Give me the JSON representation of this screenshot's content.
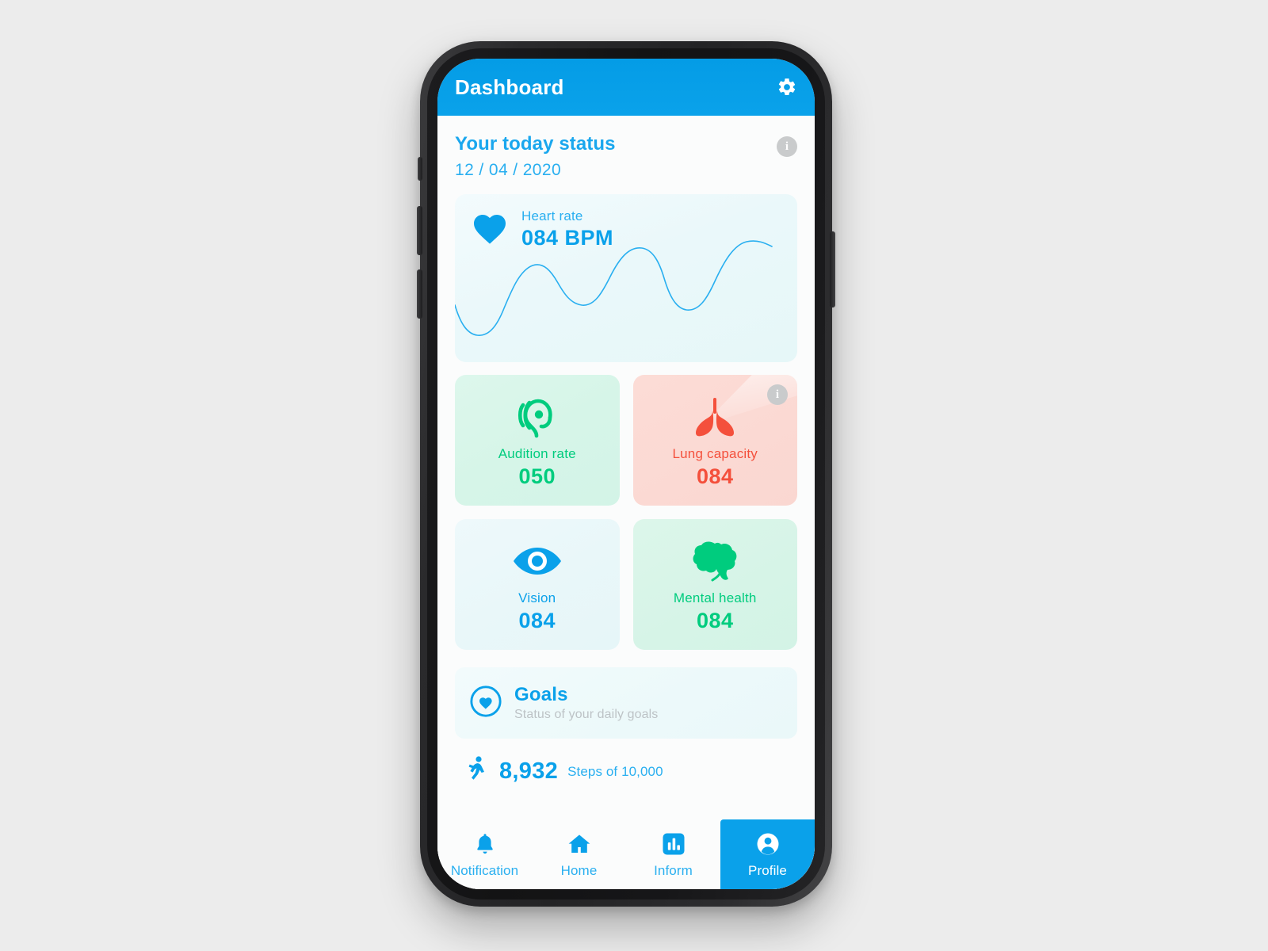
{
  "header": {
    "title": "Dashboard",
    "settings_icon": "gear-icon"
  },
  "status": {
    "title": "Your today status",
    "date": "12 / 04 / 2020",
    "info_badge": "i"
  },
  "heart_rate": {
    "icon": "heart-icon",
    "label": "Heart rate",
    "value": "084 BPM"
  },
  "metrics": [
    {
      "icon": "ear-icon",
      "label": "Audition rate",
      "value": "050",
      "theme": "green"
    },
    {
      "icon": "lungs-icon",
      "label": "Lung capacity",
      "value": "084",
      "theme": "red",
      "info_badge": "i"
    },
    {
      "icon": "eye-icon",
      "label": "Vision",
      "value": "084",
      "theme": "blue"
    },
    {
      "icon": "brain-icon",
      "label": "Mental health",
      "value": "084",
      "theme": "mint"
    }
  ],
  "goals": {
    "icon": "heart-circle-icon",
    "title": "Goals",
    "subtitle": "Status of your daily goals"
  },
  "steps": {
    "icon": "runner-icon",
    "count": "8,932",
    "caption": "Steps of 10,000"
  },
  "bottom_nav": [
    {
      "icon": "bell-icon",
      "label": "Notification",
      "active": false
    },
    {
      "icon": "home-icon",
      "label": "Home",
      "active": false
    },
    {
      "icon": "chart-icon",
      "label": "Inform",
      "active": false
    },
    {
      "icon": "person-icon",
      "label": "Profile",
      "active": true
    }
  ],
  "colors": {
    "brand_blue": "#0aa1ea",
    "header_blue": "#039be5",
    "green": "#00cc7e",
    "red": "#f4503c",
    "badge_gray": "#c9cbcc",
    "muted_gray": "#bdc3c6",
    "screen_bg": "#fbfcfc"
  }
}
